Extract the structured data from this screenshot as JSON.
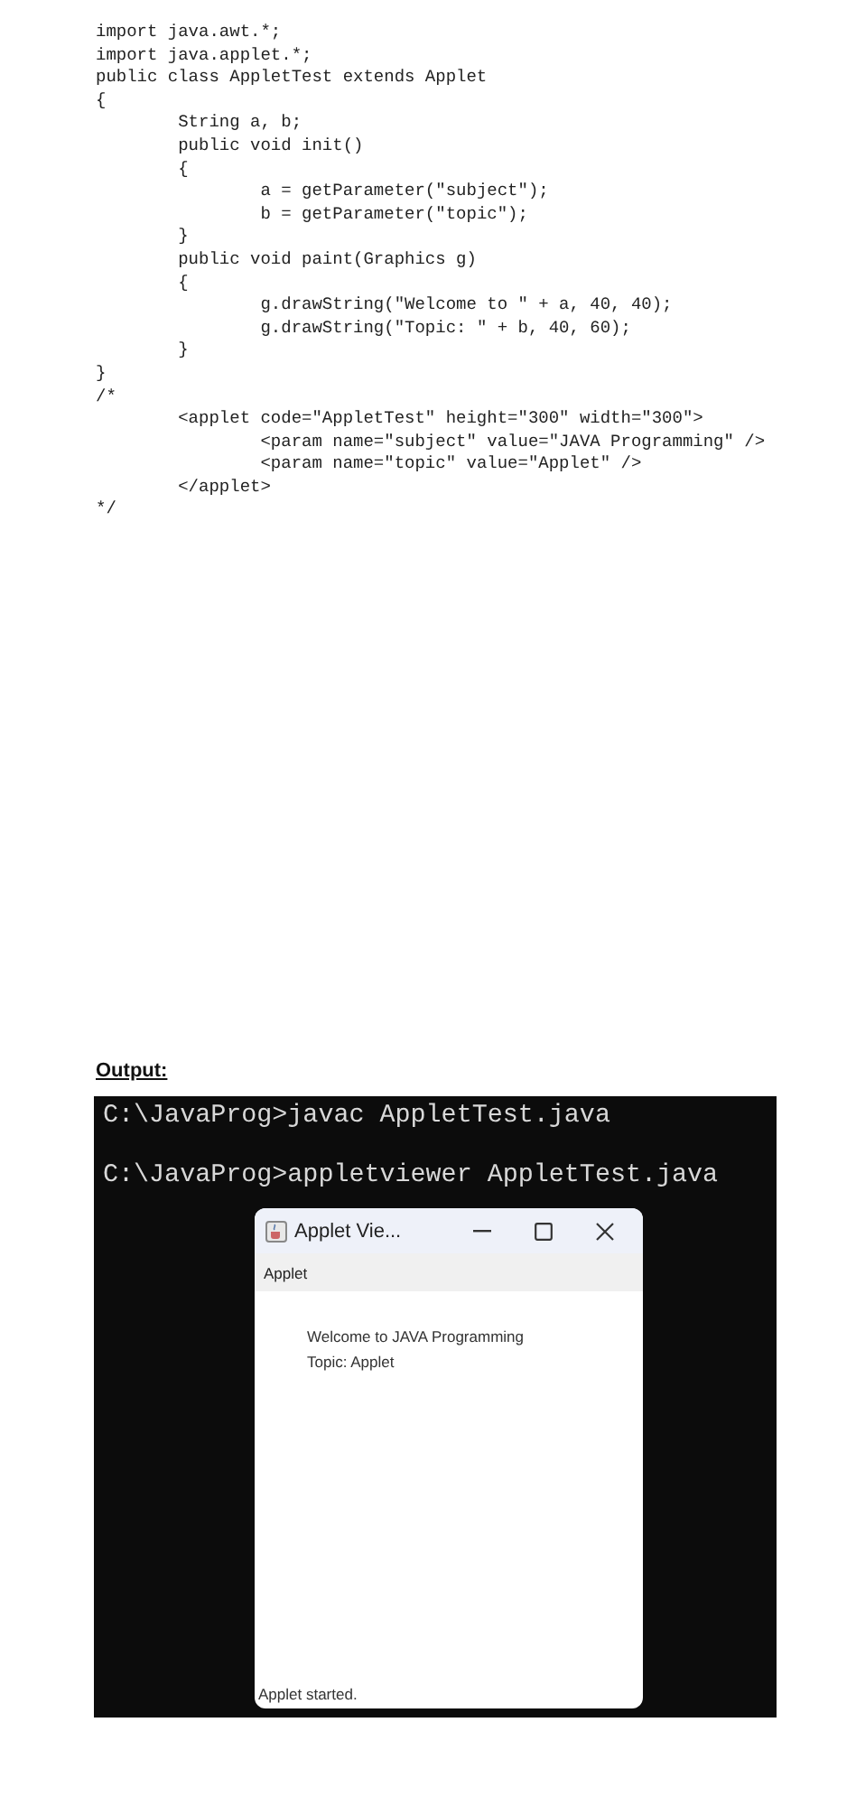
{
  "code_lines": [
    "import java.awt.*;",
    "import java.applet.*;",
    "public class AppletTest extends Applet",
    "{",
    "\tString a, b;",
    "\tpublic void init()",
    "\t{",
    "\t\ta = getParameter(\"subject\");",
    "\t\tb = getParameter(\"topic\");",
    "\t}",
    "\tpublic void paint(Graphics g)",
    "\t{",
    "\t\tg.drawString(\"Welcome to \" + a, 40, 40);",
    "\t\tg.drawString(\"Topic: \" + b, 40, 60);",
    "\t}",
    "}",
    "/*",
    "\t<applet code=\"AppletTest\" height=\"300\" width=\"300\">",
    "\t\t<param name=\"subject\" value=\"JAVA Programming\" />",
    "\t\t<param name=\"topic\" value=\"Applet\" />",
    "\t</applet>",
    "*/"
  ],
  "output": {
    "heading": "Output:",
    "console": {
      "lines": [
        "C:\\JavaProg>javac AppletTest.java",
        "C:\\JavaProg>appletviewer AppletTest.java"
      ],
      "window": {
        "title": "Applet Vie...",
        "menu": "Applet",
        "lines": [
          "Welcome to JAVA Programming",
          "Topic: Applet"
        ],
        "status": "Applet started."
      }
    }
  }
}
